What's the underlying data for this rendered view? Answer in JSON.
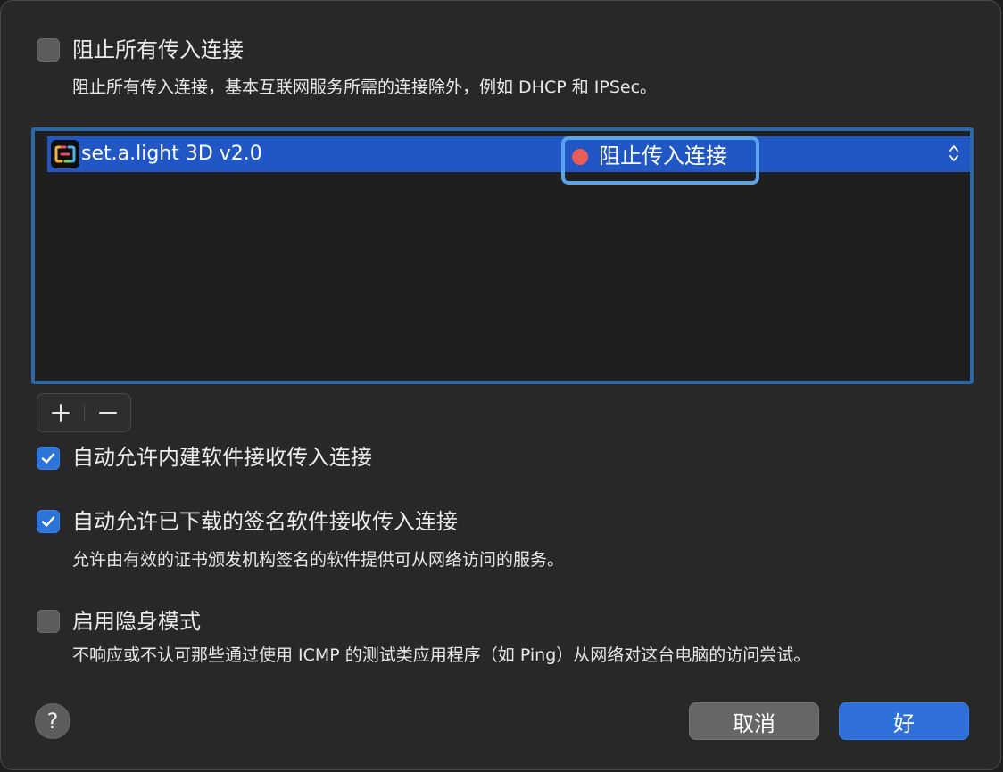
{
  "block_all": {
    "label": "阻止所有传入连接",
    "checked": false,
    "description": "阻止所有传入连接，基本互联网服务所需的连接除外，例如 DHCP 和 IPSec。"
  },
  "app_list": {
    "rows": [
      {
        "app_name": "set.a.light 3D v2.0",
        "status": "阻止传入连接",
        "status_color": "#ec5b55"
      }
    ]
  },
  "list_controls": {
    "add_symbol": "+",
    "remove_symbol": "−"
  },
  "auto_builtin": {
    "label": "自动允许内建软件接收传入连接",
    "checked": true
  },
  "auto_signed": {
    "label": "自动允许已下载的签名软件接收传入连接",
    "checked": true,
    "description": "允许由有效的证书颁发机构签名的软件提供可从网络访问的服务。"
  },
  "stealth": {
    "label": "启用隐身模式",
    "checked": false,
    "description": "不响应或不认可那些通过使用 ICMP 的测试类应用程序（如 Ping）从网络对这台电脑的访问尝试。"
  },
  "footer": {
    "help_symbol": "?",
    "cancel_label": "取消",
    "ok_label": "好"
  },
  "colors": {
    "accent": "#2e6fd9",
    "selection": "#2157c5",
    "focus_ring": "#5aa4ec",
    "block_status": "#ec5b55"
  }
}
